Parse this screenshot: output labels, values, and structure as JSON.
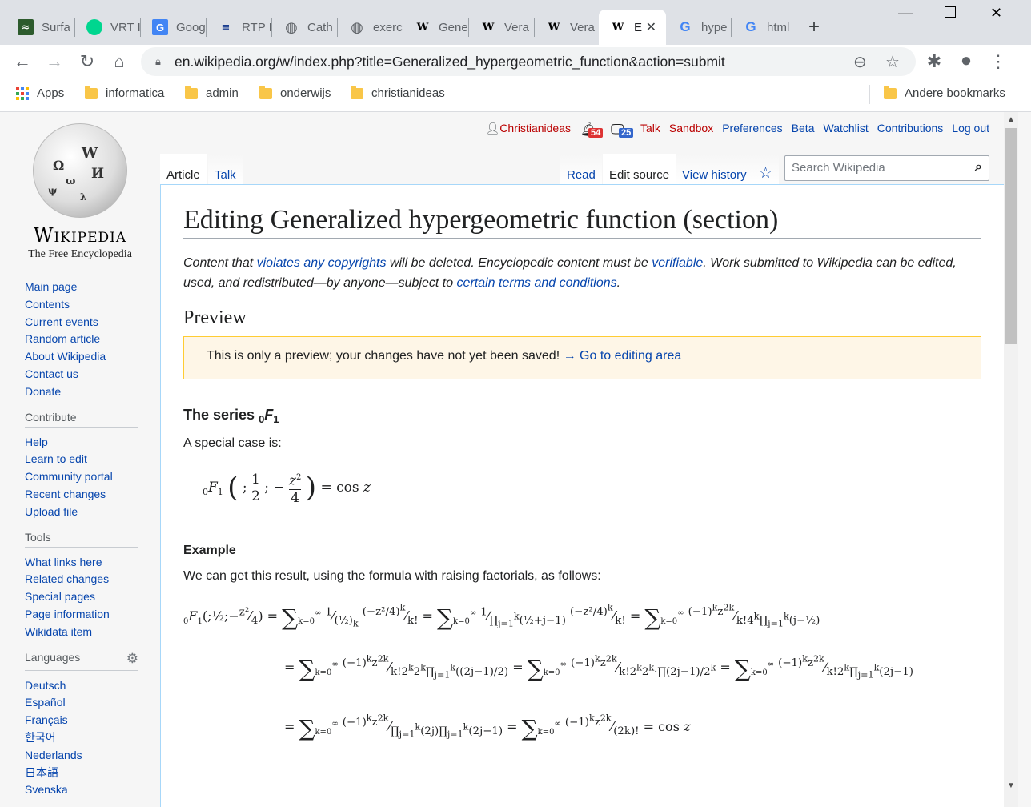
{
  "browser": {
    "tabs": [
      {
        "label": "Surfa",
        "icon": "surfline-icon"
      },
      {
        "label": "VRT I",
        "icon": "vrt-icon"
      },
      {
        "label": "Goog",
        "icon": "google-translate-icon"
      },
      {
        "label": "RTP I",
        "icon": "rtp-icon"
      },
      {
        "label": "Cath",
        "icon": "globe-icon"
      },
      {
        "label": "exerc",
        "icon": "globe-icon"
      },
      {
        "label": "Gene",
        "icon": "wikipedia-icon"
      },
      {
        "label": "Vera",
        "icon": "wikipedia-icon"
      },
      {
        "label": "Vera",
        "icon": "wikipedia-icon"
      },
      {
        "label": "E",
        "icon": "wikipedia-icon"
      },
      {
        "label": "hype",
        "icon": "google-icon"
      },
      {
        "label": "html",
        "icon": "google-icon"
      }
    ],
    "url": "en.wikipedia.org/w/index.php?title=Generalized_hypergeometric_function&action=submit",
    "bookmarks": [
      "Apps",
      "informatica",
      "admin",
      "onderwijs",
      "christianideas"
    ],
    "other_bookmarks": "Andere bookmarks"
  },
  "wiki": {
    "wordmark": "Wikipedia",
    "tagline": "The Free Encyclopedia",
    "nav": [
      "Main page",
      "Contents",
      "Current events",
      "Random article",
      "About Wikipedia",
      "Contact us",
      "Donate"
    ],
    "contribute_heading": "Contribute",
    "contribute": [
      "Help",
      "Learn to edit",
      "Community portal",
      "Recent changes",
      "Upload file"
    ],
    "tools_heading": "Tools",
    "tools": [
      "What links here",
      "Related changes",
      "Special pages",
      "Page information",
      "Wikidata item"
    ],
    "languages_heading": "Languages",
    "languages": [
      "Deutsch",
      "Español",
      "Français",
      "한국어",
      "Nederlands",
      "日本語",
      "Svenska"
    ],
    "user": "Christianideas",
    "alerts_count": "54",
    "notices_count": "25",
    "personal_links": [
      "Talk",
      "Sandbox",
      "Preferences",
      "Beta",
      "Watchlist",
      "Contributions",
      "Log out"
    ],
    "tab_article": "Article",
    "tab_talk": "Talk",
    "tab_read": "Read",
    "tab_edit": "Edit source",
    "tab_history": "View history",
    "search_placeholder": "Search Wikipedia",
    "title": "Editing Generalized hypergeometric function (section)",
    "notice": {
      "p1": "Content that ",
      "l1": "violates any copyrights",
      "p2": " will be deleted. Encyclopedic content must be ",
      "l2": "verifiable",
      "p3": ". Work submitted to Wikipedia can be edited, used, and redistributed—by anyone—subject to ",
      "l3": "certain terms and conditions",
      "p4": "."
    },
    "preview_heading": "Preview",
    "preview_msg": "This is only a preview; your changes have not yet been saved! ",
    "preview_link": "→ Go to editing area",
    "series_heading": "The series ",
    "special_case": "A special case is:",
    "example_heading": "Example",
    "example_text": "We can get this result, using the formula with raising factorials, as follows:"
  }
}
